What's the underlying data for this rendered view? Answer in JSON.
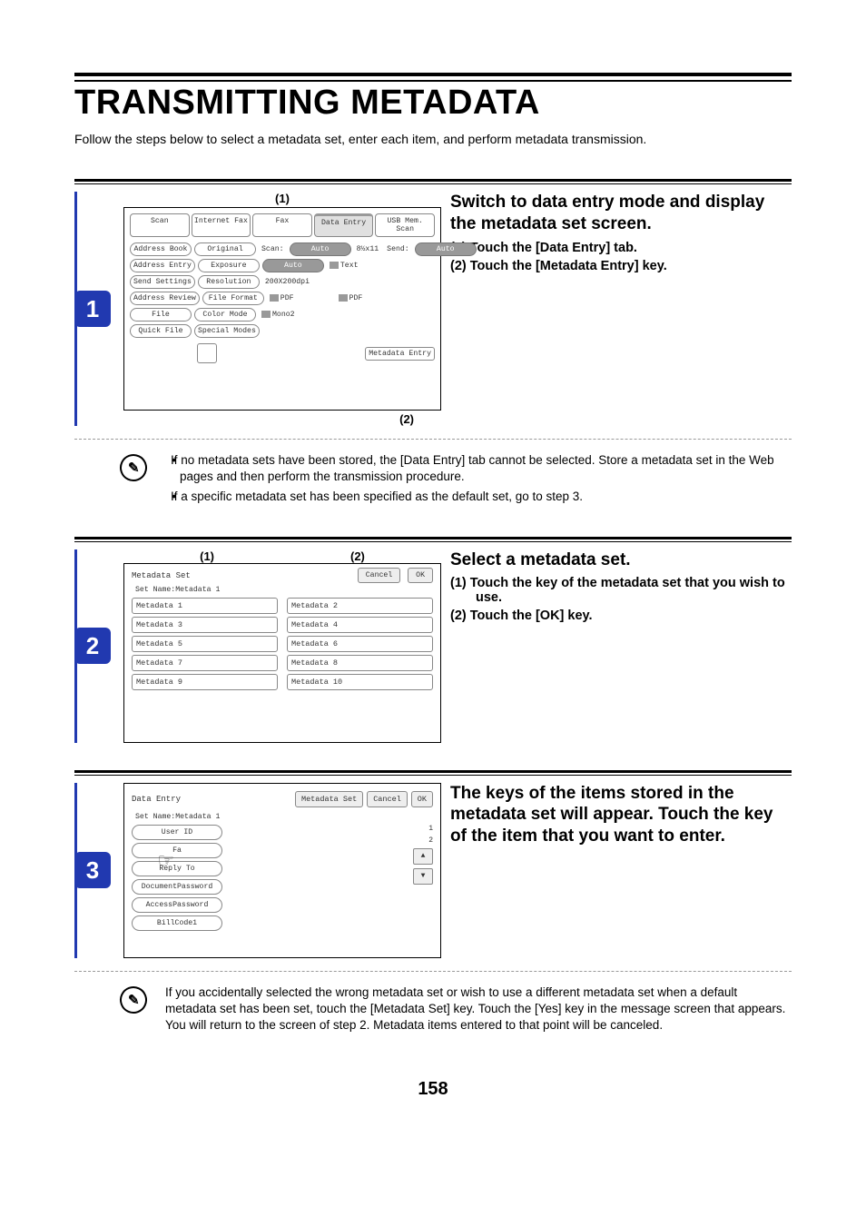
{
  "page_number": "158",
  "heading": "TRANSMITTING METADATA",
  "intro": "Follow the steps below to select a metadata set, enter each item, and perform metadata transmission.",
  "step1": {
    "badge": "1",
    "title": "Switch to data entry mode and display the metadata set screen.",
    "sub1": "(1)  Touch the [Data Entry] tab.",
    "sub2": "(2)  Touch the [Metadata Entry] key.",
    "callout_top": "(1)",
    "callout_bottom": "(2)",
    "tabs": {
      "scan": "Scan",
      "ifax": "Internet Fax",
      "fax": "Fax",
      "data_entry": "Data Entry",
      "usb": "USB Mem. Scan"
    },
    "left_btns": {
      "addr_book": "Address Book",
      "addr_entry": "Address Entry",
      "send_settings": "Send Settings",
      "addr_review": "Address Review",
      "file": "File",
      "quick_file": "Quick File"
    },
    "mid_lbls": {
      "original": "Original",
      "exposure": "Exposure",
      "resolution": "Resolution",
      "file_format": "File Format",
      "color_mode": "Color Mode",
      "special_modes": "Special Modes"
    },
    "rows": {
      "scan_label": "Scan:",
      "scan_auto": "Auto",
      "orig_size": "8½x11",
      "send_label": "Send:",
      "send_auto": "Auto",
      "exp_auto": "Auto",
      "exp_text": "Text",
      "res_val": "200X200dpi",
      "ff_pdf1": "PDF",
      "ff_pdf2": "PDF",
      "cm_mono": "Mono2"
    },
    "metadata_entry_btn": "Metadata Entry",
    "note_a": "If no metadata sets have been stored, the [Data Entry] tab cannot be selected. Store a metadata set in the Web pages and then perform the transmission procedure.",
    "note_b": "If a specific metadata set has been specified as the default set, go to step 3."
  },
  "step2": {
    "badge": "2",
    "title": "Select a metadata set.",
    "sub1": "(1)  Touch the key of the metadata set that you wish to use.",
    "sub2": "(2)  Touch the [OK] key.",
    "callout_1": "(1)",
    "callout_2": "(2)",
    "header": "Metadata Set",
    "set_name_line": "Set Name:Metadata 1",
    "cancel": "Cancel",
    "ok": "OK",
    "items": [
      "Metadata 1",
      "Metadata 2",
      "Metadata 3",
      "Metadata 4",
      "Metadata 5",
      "Metadata 6",
      "Metadata 7",
      "Metadata 8",
      "Metadata 9",
      "Metadata 10"
    ]
  },
  "step3": {
    "badge": "3",
    "title": "The keys of the items stored in the metadata set will appear. Touch the key of the item that you want to enter.",
    "header": "Data Entry",
    "metadata_set_btn": "Metadata Set",
    "cancel": "Cancel",
    "ok": "OK",
    "set_name_line": "Set Name:Metadata 1",
    "items": [
      "User ID",
      "Fa",
      "Reply To",
      "DocumentPassword",
      "AccessPassword",
      "BillCode1"
    ],
    "page_ind_1": "1",
    "page_ind_2": "2",
    "note": "If you accidentally selected the wrong metadata set or wish to use a different metadata set when a default metadata set has been set, touch the [Metadata Set] key. Touch the [Yes] key in the message screen that appears. You will return to the screen of step 2. Metadata items entered to that point will be canceled."
  }
}
